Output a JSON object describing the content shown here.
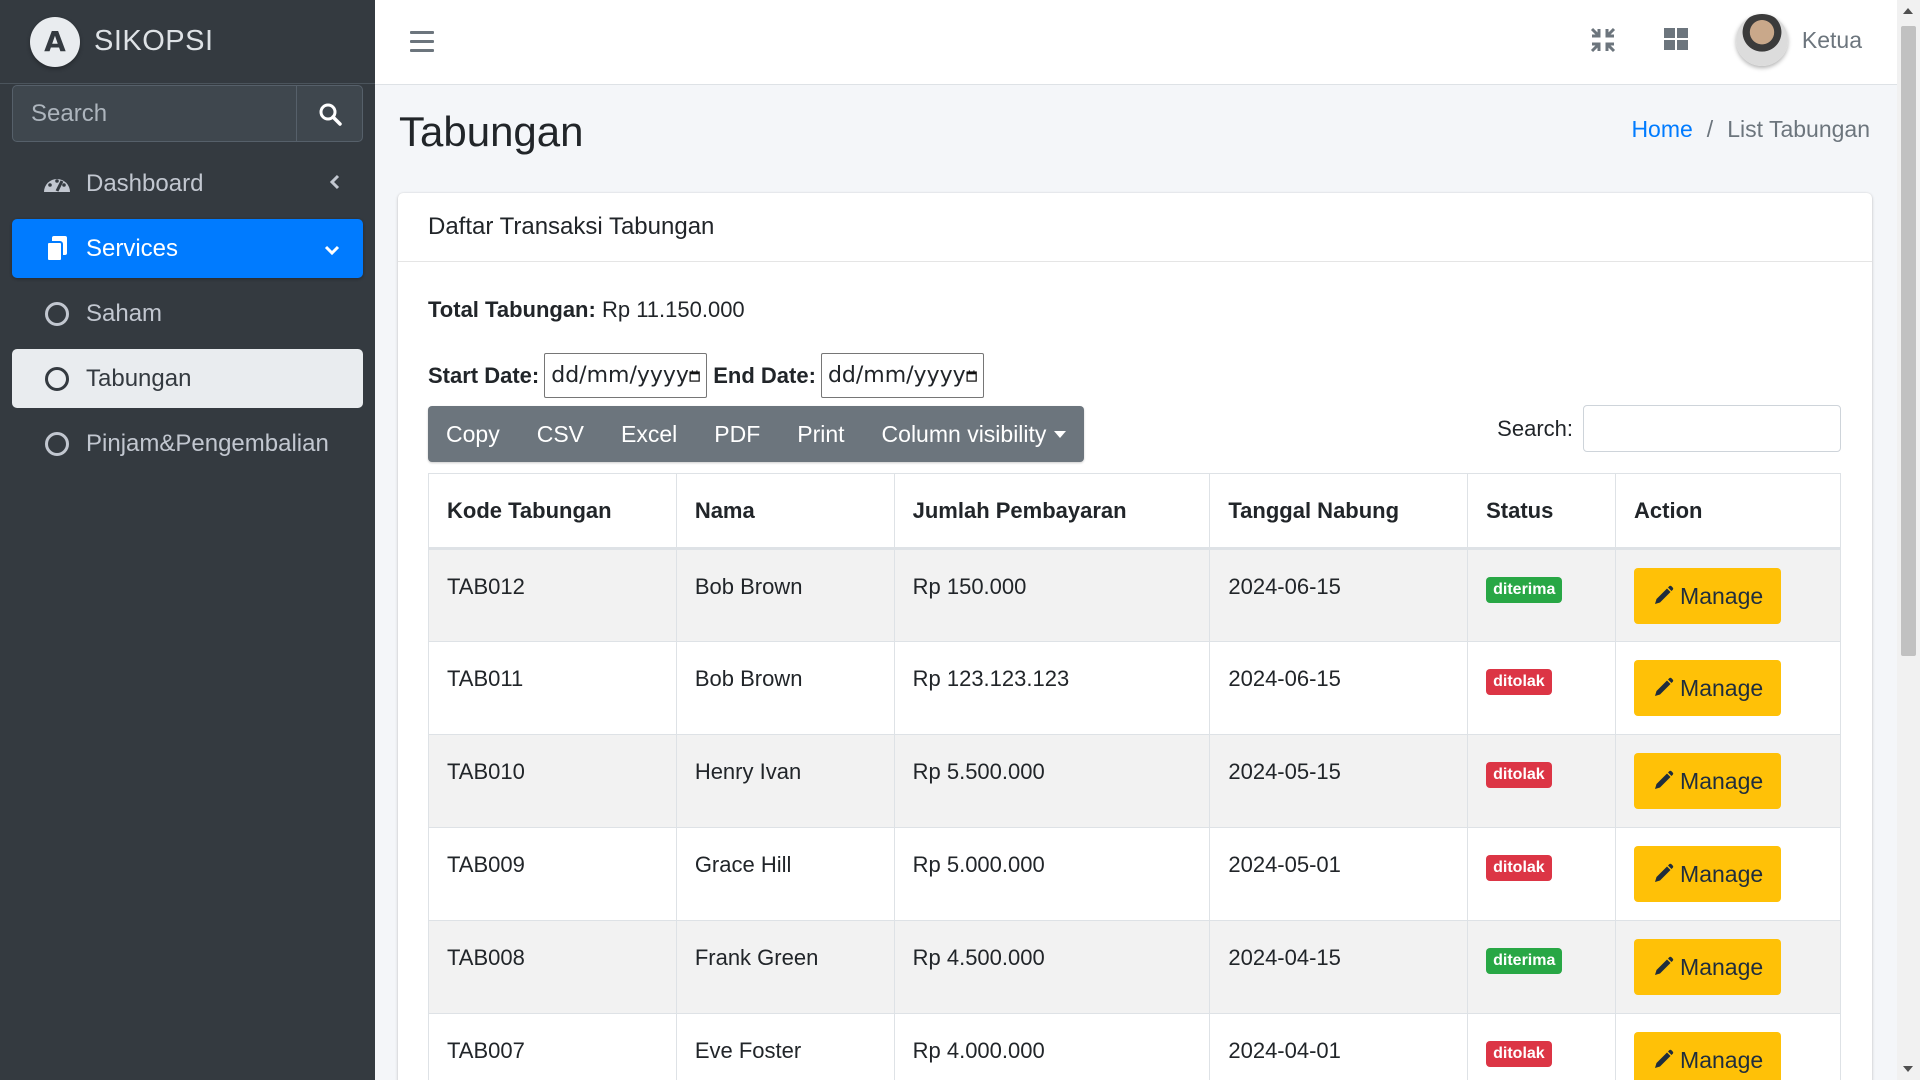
{
  "app": {
    "name": "SIKOPSI",
    "logo_letter": "A"
  },
  "sidebar": {
    "search_placeholder": "Search",
    "items": [
      {
        "label": "Dashboard",
        "icon": "tachometer-icon"
      },
      {
        "label": "Services",
        "icon": "copy-icon"
      },
      {
        "label": "Saham",
        "icon": "circle-icon"
      },
      {
        "label": "Tabungan",
        "icon": "circle-icon"
      },
      {
        "label": "Pinjam&Pengembalian",
        "icon": "circle-icon"
      }
    ]
  },
  "topbar": {
    "user_name": "Ketua"
  },
  "header": {
    "title": "Tabungan",
    "breadcrumb": {
      "home": "Home",
      "separator": "/",
      "current": "List Tabungan"
    }
  },
  "card": {
    "title": "Daftar Transaksi Tabungan",
    "total_label": "Total Tabungan:",
    "total_value": "Rp 11.150.000",
    "start_label": "Start Date:",
    "end_label": "End Date:",
    "date_placeholder": "dd/mm/yyyy",
    "buttons": [
      "Copy",
      "CSV",
      "Excel",
      "PDF",
      "Print",
      "Column visibility"
    ],
    "search_label": "Search:"
  },
  "table": {
    "columns": [
      "Kode Tabungan",
      "Nama",
      "Jumlah Pembayaran",
      "Tanggal Nabung",
      "Status",
      "Action"
    ],
    "action_label": "Manage",
    "rows": [
      {
        "kode": "TAB012",
        "nama": "Bob Brown",
        "jumlah": "Rp 150.000",
        "tanggal": "2024-06-15",
        "status": "diterima"
      },
      {
        "kode": "TAB011",
        "nama": "Bob Brown",
        "jumlah": "Rp 123.123.123",
        "tanggal": "2024-06-15",
        "status": "ditolak"
      },
      {
        "kode": "TAB010",
        "nama": "Henry Ivan",
        "jumlah": "Rp 5.500.000",
        "tanggal": "2024-05-15",
        "status": "ditolak"
      },
      {
        "kode": "TAB009",
        "nama": "Grace Hill",
        "jumlah": "Rp 5.000.000",
        "tanggal": "2024-05-01",
        "status": "ditolak"
      },
      {
        "kode": "TAB008",
        "nama": "Frank Green",
        "jumlah": "Rp 4.500.000",
        "tanggal": "2024-04-15",
        "status": "diterima"
      },
      {
        "kode": "TAB007",
        "nama": "Eve Foster",
        "jumlah": "Rp 4.000.000",
        "tanggal": "2024-04-01",
        "status": "ditolak"
      }
    ]
  },
  "colors": {
    "primary": "#007bff",
    "sidebar": "#343a40",
    "success": "#28a745",
    "danger": "#dc3545",
    "warning": "#ffc107",
    "secondary": "#6c757d"
  }
}
